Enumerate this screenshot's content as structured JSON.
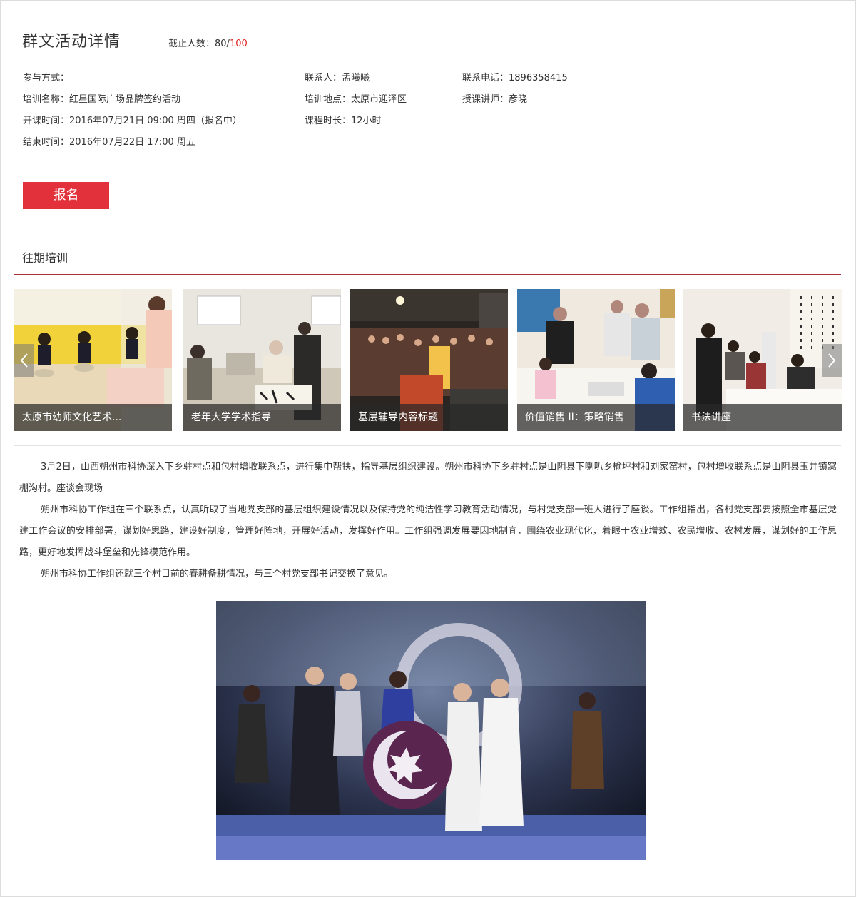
{
  "header": {
    "title": "群文活动详情",
    "quota_label": "截止人数：",
    "quota_current": "80/",
    "quota_max": "100"
  },
  "info": {
    "participation": "参与方式：",
    "training_name": "培训名称：红星国际广场品牌签约活动",
    "start_time": "开课时间：2016年07月21日 09:00 周四（报名中）",
    "end_time": "结束时间：2016年07月22日 17:00 周五",
    "contact": "联系人：孟曦曦",
    "location": "培训地点：太原市迎泽区",
    "duration": "课程时长：12小时",
    "phone": "联系电话：1896358415",
    "lecturer": "授课讲师：彦晓"
  },
  "signup_label": "报名",
  "past": {
    "title": "往期培训",
    "items": [
      {
        "caption": "太原市幼师文化艺术..."
      },
      {
        "caption": "老年大学学术指导"
      },
      {
        "caption": "基层辅导内容标题"
      },
      {
        "caption": "价值销售 II：策略销售"
      },
      {
        "caption": "书法讲座"
      }
    ]
  },
  "article": {
    "paragraphs": [
      "3月2日，山西朔州市科协深入下乡驻村点和包村增收联系点，进行集中帮扶，指导基层组织建设。朔州市科协下乡驻村点是山阴县下喇叭乡榆坪村和刘家窑村，包村增收联系点是山阴县玉井镇窝棚沟村。座谈会现场",
      "朔州市科协工作组在三个联系点，认真听取了当地党支部的基层组织建设情况以及保持党的纯洁性学习教育活动情况，与村党支部一班人进行了座谈。工作组指出，各村党支部要按照全市基层党建工作会议的安排部署，谋划好思路，建设好制度，管理好阵地，开展好活动，发挥好作用。工作组强调发展要因地制宜，围绕农业现代化，着眼于农业增效、农民增收、农村发展，谋划好的工作思路，更好地发挥战斗堡垒和先锋模范作用。",
      "朔州市科协工作组还就三个村目前的春耕备耕情况，与三个村党支部书记交换了意见。"
    ]
  },
  "colors": {
    "accent": "#e2313a",
    "quota_max": "#e02020",
    "section_rule": "#a8323a"
  }
}
